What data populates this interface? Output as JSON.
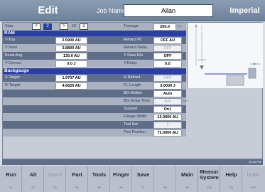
{
  "header": {
    "title": "Edit",
    "job_label": "Job Name",
    "job_name": "Allan",
    "units": "Imperial"
  },
  "step_row": {
    "label": "Step",
    "prev": "<",
    "current": "2",
    "next": ">",
    "of_label": "Of",
    "total": "2",
    "tonnage_label": "Tonnage",
    "tonnage_value": "250.0",
    "tonnage_unit": "Ton"
  },
  "ram": {
    "heading": "RAM",
    "left": [
      {
        "label": "Y-Top",
        "value": "2.5900 AU"
      },
      {
        "label": "Y-Slow",
        "value": "3.8800 AU"
      },
      {
        "label": "Bend-Ang",
        "value": "130.0 AU"
      },
      {
        "label": "Y-Correct",
        "value": "0.0 J"
      }
    ],
    "right": [
      {
        "label": "Retract Pt.",
        "value": "OFF AU",
        "disabled": false
      },
      {
        "label": "Retract Delay",
        "value": "OFF",
        "disabled": true
      },
      {
        "label": "Y-Slow Rtn",
        "value": "OFF",
        "disabled": false
      },
      {
        "label": "Y-Delay",
        "value": "0.0",
        "disabled": false
      }
    ]
  },
  "backgauge": {
    "heading": "Backgauge",
    "left": [
      {
        "label": "X-Target",
        "value": "1.9737 AU"
      },
      {
        "label": "R-Target",
        "value": "4.6620 AU"
      }
    ],
    "right": [
      {
        "label": "X-Retract",
        "value": "OFF",
        "disabled": true
      },
      {
        "label": "Fl. Length",
        "value": "3.0000 J",
        "disabled": false
      },
      {
        "label": "BG-Motion",
        "value": "Auto",
        "disabled": false
      },
      {
        "label": "BG Delay Time",
        "value": "N/A",
        "disabled": true,
        "unit": "Sec"
      },
      {
        "label": "Support",
        "value": "On1",
        "disabled": false
      },
      {
        "label": "Flange Width",
        "value": "12.0000 AU",
        "disabled": false
      },
      {
        "label": "Tool Set",
        "value": "1",
        "disabled": true
      },
      {
        "label": "Part Position",
        "value": "72.0000 AU",
        "disabled": false
      }
    ]
  },
  "status": {
    "time": "02:18 PM"
  },
  "fkeys": [
    {
      "label": "Run",
      "key": "F1",
      "enabled": true
    },
    {
      "label": "Alt",
      "key": "F2",
      "enabled": true
    },
    {
      "label": "Zoom",
      "key": "F3",
      "enabled": false
    },
    {
      "label": "Part",
      "key": "F4",
      "enabled": true
    },
    {
      "label": "Tools",
      "key": "F5",
      "enabled": true
    },
    {
      "label": "Finger",
      "key": "F6",
      "enabled": true
    },
    {
      "label": "Save",
      "key": "F7",
      "enabled": true
    },
    {
      "label": "",
      "key": "F8",
      "enabled": false
    },
    {
      "label": "Main",
      "key": "F9",
      "enabled": true
    },
    {
      "label": "Measur System",
      "key": "F10",
      "enabled": true
    },
    {
      "label": "Help",
      "key": "F11",
      "enabled": true
    },
    {
      "label": "Undo",
      "key": "F12",
      "enabled": false
    }
  ]
}
